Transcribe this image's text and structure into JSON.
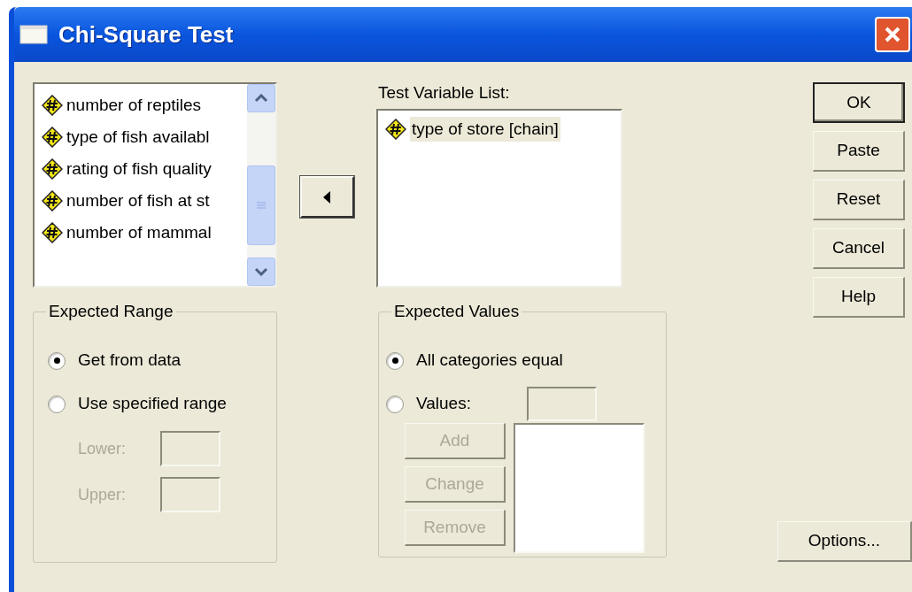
{
  "window": {
    "title": "Chi-Square Test"
  },
  "source_list": {
    "items": [
      {
        "label": "number of reptiles"
      },
      {
        "label": "type of fish availabl"
      },
      {
        "label": "rating of fish quality"
      },
      {
        "label": "number of fish at st"
      },
      {
        "label": "number of mammal"
      }
    ]
  },
  "test_variable_list": {
    "label": "Test Variable List:",
    "items": [
      {
        "label": "type of store [chain]",
        "selected": true
      }
    ]
  },
  "expected_range": {
    "title": "Expected Range",
    "options": [
      {
        "label": "Get from data",
        "selected": true
      },
      {
        "label": "Use specified range",
        "selected": false
      }
    ],
    "fields": [
      {
        "label": "Lower:",
        "disabled": true
      },
      {
        "label": "Upper:",
        "disabled": true
      }
    ]
  },
  "expected_values": {
    "title": "Expected Values",
    "options": [
      {
        "label": "All categories equal",
        "selected": true,
        "kind": "radio"
      },
      {
        "label": "Values:",
        "selected": false,
        "kind": "radio-field"
      }
    ],
    "buttons": [
      {
        "label": "Add",
        "disabled": true
      },
      {
        "label": "Change",
        "disabled": true
      },
      {
        "label": "Remove",
        "disabled": true
      }
    ]
  },
  "buttons": [
    {
      "label": "OK",
      "default": true
    },
    {
      "label": "Paste",
      "default": false
    },
    {
      "label": "Reset",
      "default": false
    },
    {
      "label": "Cancel",
      "default": false
    },
    {
      "label": "Help",
      "default": false
    }
  ],
  "options_button": {
    "label": "Options..."
  }
}
